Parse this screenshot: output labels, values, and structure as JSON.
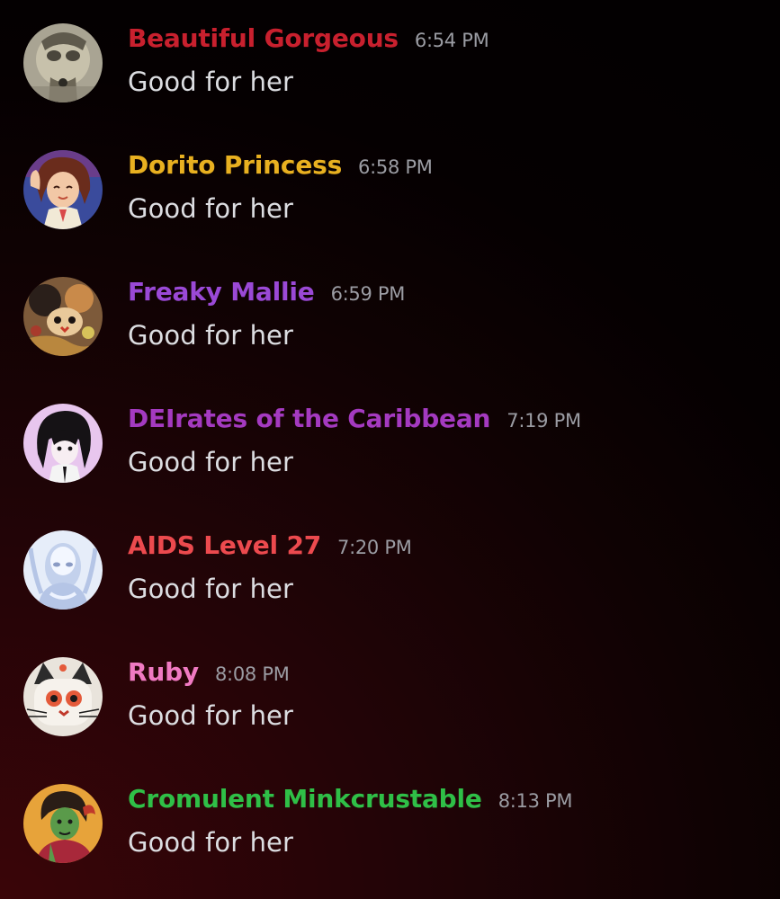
{
  "messages": [
    {
      "author": "Beautiful Gorgeous",
      "author_color": "#c8202e",
      "time": "6:54 PM",
      "text": "Good for her",
      "avatar": "avatar-grayscale-illustration"
    },
    {
      "author": "Dorito Princess",
      "author_color": "#e8b020",
      "time": "6:58 PM",
      "text": "Good for her",
      "avatar": "avatar-anime-girl-waving"
    },
    {
      "author": "Freaky Mallie",
      "author_color": "#9a49d6",
      "time": "6:59 PM",
      "text": "Good for her",
      "avatar": "avatar-creature-illustration"
    },
    {
      "author": "DEIrates of the Caribbean",
      "author_color": "#a43ac0",
      "time": "7:19 PM",
      "text": "Good for her",
      "avatar": "avatar-dark-haired-character"
    },
    {
      "author": "AIDS Level 27",
      "author_color": "#ec4a4e",
      "time": "7:20 PM",
      "text": "Good for her",
      "avatar": "avatar-silver-figure"
    },
    {
      "author": "Ruby",
      "author_color": "#f07ac2",
      "time": "8:08 PM",
      "text": "Good for her",
      "avatar": "avatar-cat-mask"
    },
    {
      "author": "Cromulent Minkcrustable",
      "author_color": "#2fbf47",
      "time": "8:13 PM",
      "text": "Good for her",
      "avatar": "avatar-green-skinned-character"
    }
  ]
}
